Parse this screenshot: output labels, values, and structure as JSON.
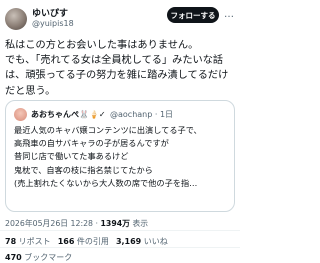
{
  "author": {
    "display_name": "ゆいぴす",
    "handle": "@yuipis18"
  },
  "follow_button": {
    "label": "フォローする"
  },
  "more_icon": "…",
  "tweet": {
    "text": "私はこの方とお会いした事はありません。\nでも、「売れてる女は全員枕してる」みたいな話は、頑張ってる子の努力を雑に踏み潰してるだけだと思う。"
  },
  "quote": {
    "display_name": "あおちゃんぺ🐰🍦✓",
    "handle_time": "@aochanp · 1日",
    "text": "最近人気のキャバ嬢コンテンツに出演してる子で、\n高飛車の自サバキャラの子が居るんですが\n昔同じ店で働いてた事あるけど\n鬼枕で、自客の枝に指名禁じてたから\n(売上割れたくないから大人数の席で他の子を指…"
  },
  "meta": {
    "datetime": "2026年05月26日 12:28",
    "separator": " · ",
    "views_count": "1394万",
    "views_label": " 表示"
  },
  "stats": {
    "retweets_count": "78",
    "retweets_label": " リポスト",
    "quotes_count": "166",
    "quotes_label": " 件の引用",
    "likes_count": "3,169",
    "likes_label": " いいね",
    "bookmarks_count": "470",
    "bookmarks_label": " ブックマーク"
  }
}
